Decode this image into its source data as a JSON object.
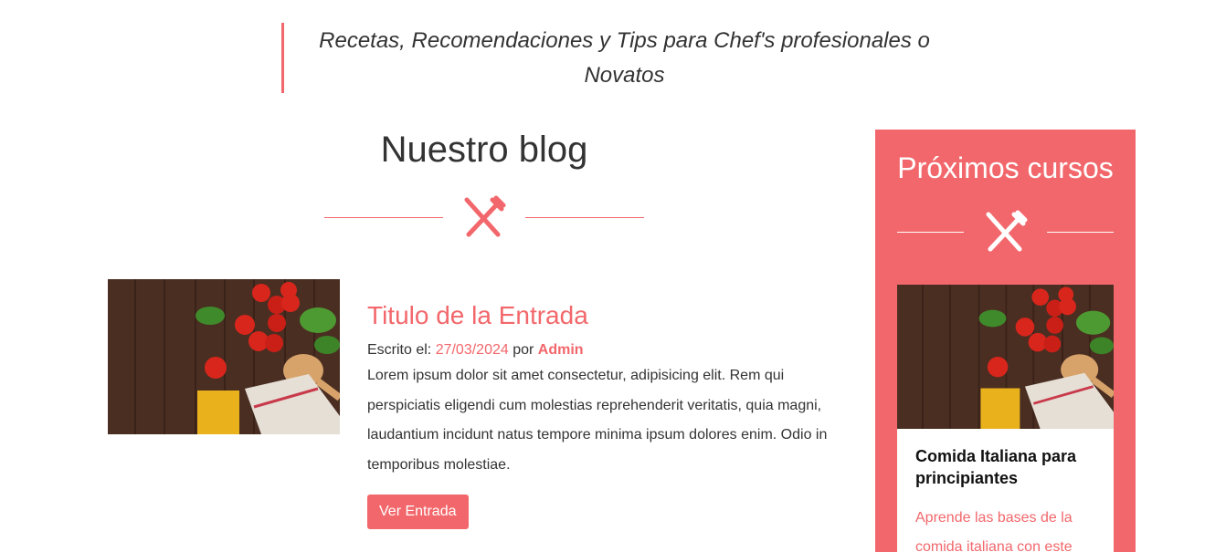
{
  "tagline": "Recetas, Recomendaciones y Tips para Chef's profesionales o Novatos",
  "blog": {
    "title": "Nuestro blog",
    "icon": "fork-knife-icon",
    "entry": {
      "image": "food-photo",
      "title": "Titulo de la Entrada",
      "meta_label": "Escrito el: ",
      "date": "27/03/2024",
      "by_label": " por ",
      "author": "Admin",
      "text": "Lorem ipsum dolor sit amet consectetur, adipisicing elit. Rem qui perspiciatis eligendi cum molestias reprehenderit veritatis, quia magni, laudantium incidunt natus tempore minima ipsum dolores enim. Odio in temporibus molestiae.",
      "button_label": "Ver Entrada"
    }
  },
  "sidebar": {
    "title": "Próximos cursos",
    "icon": "fork-knife-icon",
    "course": {
      "image": "food-photo",
      "title": "Comida Italiana para principiantes",
      "text": "Aprende las bases de la comida italiana con este"
    }
  },
  "colors": {
    "accent": "#f2676b",
    "text": "#333333",
    "background": "#ffffff"
  }
}
